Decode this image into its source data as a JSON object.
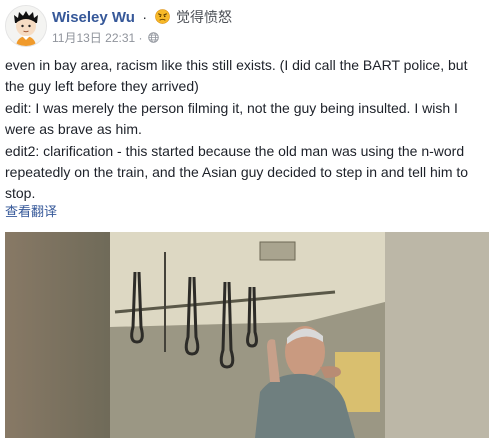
{
  "post": {
    "author": "Wiseley Wu",
    "separator": "·",
    "feeling": "觉得愤怒",
    "timestamp": "11月13日 22:31",
    "meta_separator": "·",
    "privacy_icon": "globe-icon",
    "feeling_icon": "angry-face-icon",
    "paragraphs": [
      "even in bay area, racism like this still exists. (I did call the BART police, but the guy left before they arrived)",
      "edit: I was merely the person filming it, not the guy being insulted. I wish I were as brave as him.",
      "edit2: clarification - this started because the old man was using the n-word repeatedly on the train, and the Asian guy decided to step in and tell him to stop."
    ],
    "see_translation": "查看翻译"
  },
  "colors": {
    "link": "#365899",
    "text": "#1d2129",
    "meta": "#90949c"
  }
}
